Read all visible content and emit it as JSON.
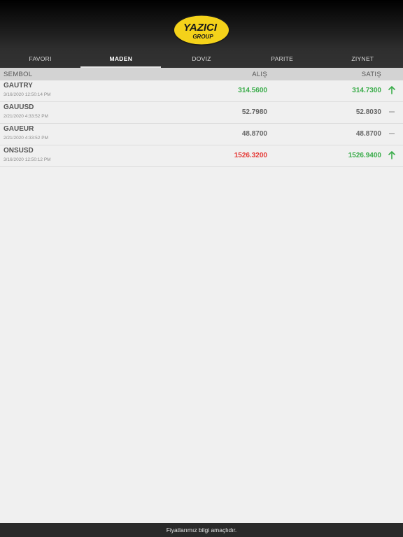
{
  "logo": {
    "word1": "YAZICI",
    "word2": "GROUP"
  },
  "tabs": [
    {
      "label": "FAVORI",
      "active": false
    },
    {
      "label": "MADEN",
      "active": true
    },
    {
      "label": "DOVIZ",
      "active": false
    },
    {
      "label": "PARITE",
      "active": false
    },
    {
      "label": "ZIYNET",
      "active": false
    }
  ],
  "columns": {
    "symbol": "SEMBOL",
    "alis": "ALIŞ",
    "satis": "SATIŞ"
  },
  "rows": [
    {
      "symbol": "GAUTRY",
      "time": "3/16/2020 12:50:14 PM",
      "alis": "314.5600",
      "alis_color": "#3aac4a",
      "satis": "314.7300",
      "satis_color": "#3aac4a",
      "trend": "up-arrow-icon"
    },
    {
      "symbol": "GAUUSD",
      "time": "2/21/2020 4:33:52 PM",
      "alis": "52.7980",
      "alis_color": "#666666",
      "satis": "52.8030",
      "satis_color": "#666666",
      "trend": "dash-icon"
    },
    {
      "symbol": "GAUEUR",
      "time": "2/21/2020 4:33:52 PM",
      "alis": "48.8700",
      "alis_color": "#666666",
      "satis": "48.8700",
      "satis_color": "#666666",
      "trend": "dash-icon"
    },
    {
      "symbol": "ONSUSD",
      "time": "3/16/2020 12:50:12 PM",
      "alis": "1526.3200",
      "alis_color": "#e53935",
      "satis": "1526.9400",
      "satis_color": "#3aac4a",
      "trend": "up-arrow-icon"
    }
  ],
  "footer": {
    "text": "Fiyatlarımız bilgi amaçlıdır."
  },
  "colors": {
    "up": "#3aac4a",
    "down": "#e53935",
    "flat": "#666666",
    "header_bg": "#333333",
    "logo_yellow": "#f4d21a"
  }
}
